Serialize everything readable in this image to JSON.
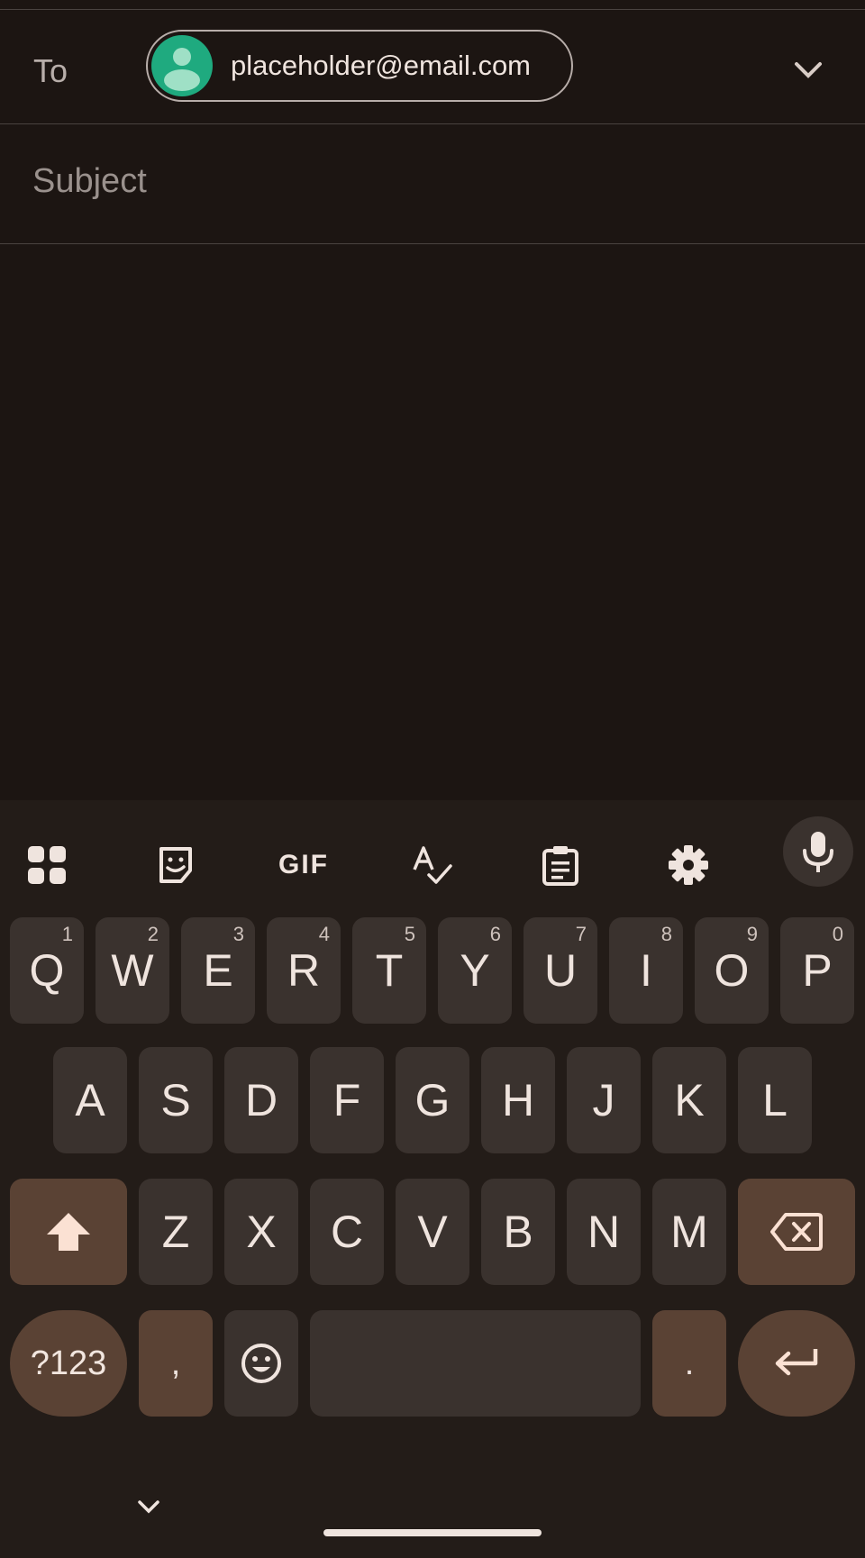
{
  "compose": {
    "to_label": "To",
    "recipient": "placeholder@email.com",
    "subject_placeholder": "Subject"
  },
  "keyboard": {
    "toolbar": [
      "apps-grid-icon",
      "sticker-icon",
      "gif-icon",
      "spellcheck-icon",
      "clipboard-icon",
      "settings-icon",
      "mic-icon"
    ],
    "gif_label": "GIF",
    "row1": [
      {
        "label": "Q",
        "hint": "1"
      },
      {
        "label": "W",
        "hint": "2"
      },
      {
        "label": "E",
        "hint": "3"
      },
      {
        "label": "R",
        "hint": "4"
      },
      {
        "label": "T",
        "hint": "5"
      },
      {
        "label": "Y",
        "hint": "6"
      },
      {
        "label": "U",
        "hint": "7"
      },
      {
        "label": "I",
        "hint": "8"
      },
      {
        "label": "O",
        "hint": "9"
      },
      {
        "label": "P",
        "hint": "0"
      }
    ],
    "row2": [
      "A",
      "S",
      "D",
      "F",
      "G",
      "H",
      "J",
      "K",
      "L"
    ],
    "row3": [
      "Z",
      "X",
      "C",
      "V",
      "B",
      "N",
      "M"
    ],
    "symbols_label": "?123",
    "comma_label": ",",
    "period_label": ".",
    "colors": {
      "key": "#3a322e",
      "modifier": "#5a4234",
      "background": "#231c18"
    }
  }
}
